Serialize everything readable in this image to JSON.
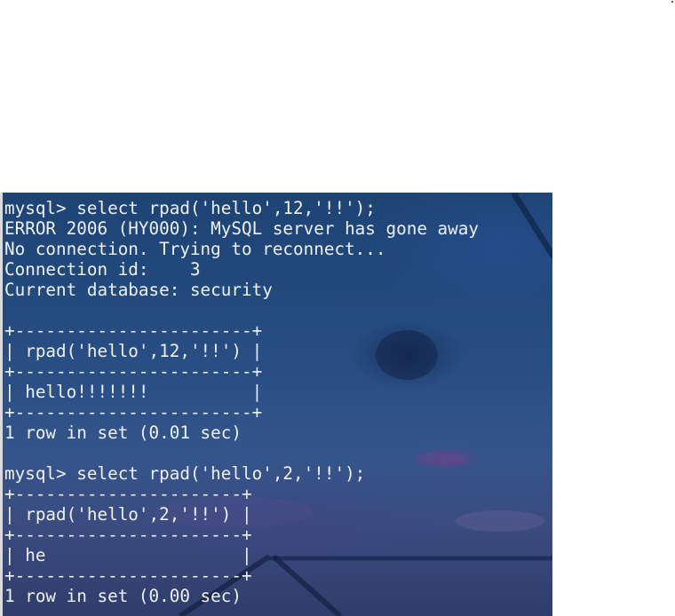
{
  "terminal": {
    "lines": [
      "mysql> select rpad('hello',12,'!!');",
      "ERROR 2006 (HY000): MySQL server has gone away",
      "No connection. Trying to reconnect...",
      "Connection id:    3",
      "Current database: security",
      "",
      "+-----------------------+",
      "| rpad('hello',12,'!!') |",
      "+-----------------------+",
      "| hello!!!!!!!          |",
      "+-----------------------+",
      "1 row in set (0.01 sec)",
      "",
      "mysql> select rpad('hello',2,'!!');",
      "+----------------------+",
      "| rpad('hello',2,'!!') |",
      "+----------------------+",
      "| he                   |",
      "+----------------------+",
      "1 row in set (0.00 sec)"
    ]
  },
  "colors": {
    "terminal_text": "#eef1f6",
    "terminal_bg": "#22497c",
    "page_bg": "#ffffff"
  }
}
